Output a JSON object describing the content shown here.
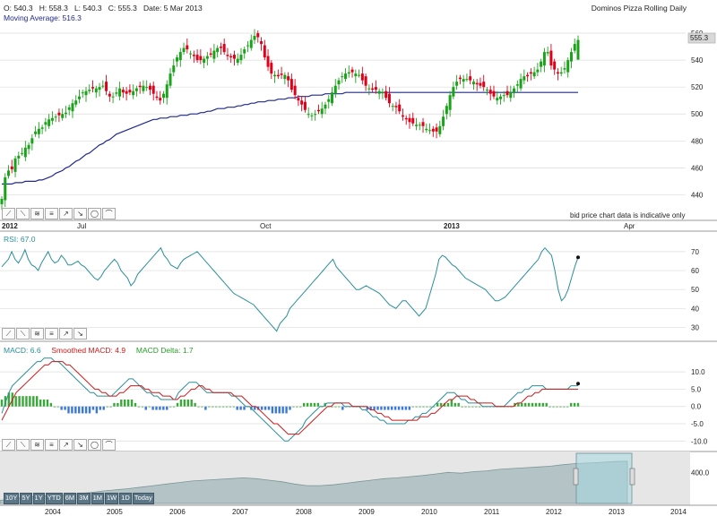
{
  "header": {
    "open": "O: 540.3",
    "high": "H: 558.3",
    "low": "L: 540.3",
    "close": "C: 555.3",
    "date": "Date: 5 Mar 2013",
    "title": "Dominos Pizza Rolling Daily",
    "ma_label": "Moving Average: 516.3",
    "price_tag": "555.3",
    "note": "bid price chart data is indicative only"
  },
  "rsi_label": "RSI: 67.0",
  "macd": {
    "macd_label": "MACD: 6.6",
    "smoothed_label": "Smoothed MACD: 4.9",
    "delta_label": "MACD Delta: 1.7"
  },
  "tool_icons": [
    "line-tool-icon",
    "trend-down-icon",
    "trend-waves-icon",
    "fibonacci-icon",
    "arrow-up-right-icon",
    "arrow-down-right-icon",
    "ellipse-icon",
    "arc-icon"
  ],
  "range_buttons": [
    "10Y",
    "5Y",
    "1Y",
    "YTD",
    "6M",
    "3M",
    "1M",
    "1W",
    "1D",
    "Today"
  ],
  "colors": {
    "up": "#1aa31a",
    "down": "#e0001a",
    "ma": "#1f2a8c",
    "rsi": "#2a8f9a",
    "macd": "#2a8f9a",
    "smoothed": "#d01919",
    "delta_pos": "#3aa83a",
    "delta_neg": "#3b78d8",
    "nav_fill": "#b4c4c6"
  },
  "chart_data": [
    {
      "type": "candlestick",
      "title": "Dominos Pizza Rolling Daily",
      "x_ticks": [
        "2012",
        "Jul",
        "Oct",
        "2013",
        "Apr"
      ],
      "y_ticks": [
        440,
        460,
        480,
        500,
        520,
        540,
        560
      ],
      "ylim": [
        425,
        570
      ],
      "closes": [
        437,
        453,
        458,
        459,
        467,
        469,
        471,
        475,
        477,
        482,
        487,
        489,
        490,
        494,
        496,
        497,
        498,
        499,
        500,
        501,
        505,
        508,
        510,
        513,
        516,
        517,
        518,
        519,
        519,
        520,
        521,
        517,
        513,
        513,
        516,
        519,
        516,
        515,
        516,
        517,
        519,
        520,
        521,
        520,
        518,
        515,
        512,
        510,
        515,
        522,
        530,
        536,
        542,
        546,
        549,
        548,
        545,
        543,
        540,
        540,
        541,
        543,
        544,
        547,
        549,
        549,
        546,
        543,
        542,
        541,
        541,
        544,
        548,
        551,
        555,
        558,
        557,
        552,
        542,
        535,
        530,
        529,
        528,
        529,
        529,
        525,
        518,
        514,
        510,
        507,
        503,
        500,
        499,
        500,
        502,
        504,
        507,
        511,
        516,
        521,
        525,
        528,
        530,
        531,
        531,
        530,
        529,
        525,
        521,
        519,
        518,
        518,
        517,
        516,
        512,
        508,
        506,
        505,
        502,
        498,
        496,
        494,
        493,
        492,
        492,
        491,
        489,
        488,
        487,
        487,
        491,
        498,
        506,
        514,
        520,
        524,
        526,
        526,
        526,
        525,
        524,
        522,
        521,
        520,
        518,
        515,
        513,
        512,
        513,
        514,
        514,
        516,
        519,
        522,
        526,
        528,
        528,
        530,
        531,
        533,
        539,
        546,
        546,
        536,
        533,
        530,
        531,
        534,
        540,
        546,
        552,
        555
      ],
      "moving_average": [
        448,
        448,
        448,
        448,
        449,
        449,
        449,
        450,
        450,
        450,
        450,
        451,
        451,
        452,
        453,
        454,
        456,
        457,
        458,
        460,
        461,
        463,
        465,
        466,
        468,
        470,
        471,
        473,
        475,
        477,
        478,
        480,
        481,
        483,
        485,
        486,
        487,
        488,
        489,
        490,
        491,
        492,
        493,
        494,
        495,
        496,
        496,
        497,
        497,
        497,
        498,
        498,
        498,
        499,
        499,
        499,
        500,
        500,
        500,
        501,
        501,
        502,
        502,
        503,
        504,
        504,
        504,
        505,
        505,
        505,
        506,
        506,
        507,
        507,
        508,
        508,
        509,
        509,
        509,
        510,
        510,
        510,
        511,
        511,
        511,
        512,
        512,
        512,
        513,
        513,
        513,
        513,
        514,
        514,
        514,
        514,
        515,
        515,
        515,
        515,
        515,
        515,
        516,
        516,
        516,
        516,
        516,
        516,
        516,
        516,
        516,
        516,
        516,
        516,
        516,
        516,
        516,
        516,
        516,
        516,
        516,
        516,
        516,
        516,
        516,
        516,
        516,
        516,
        516,
        516,
        516,
        516,
        516,
        516,
        516,
        516,
        516,
        516,
        516,
        516,
        516,
        516,
        516,
        516,
        516,
        516,
        516,
        516,
        516,
        516,
        516,
        516,
        516,
        516,
        516,
        516,
        516,
        516,
        516,
        516,
        516,
        516,
        516,
        516,
        516,
        516,
        516,
        516,
        516,
        516,
        516,
        516
      ],
      "last": {
        "open": 540.3,
        "high": 558.3,
        "low": 540.3,
        "close": 555.3,
        "moving_average": 516.3
      }
    },
    {
      "type": "line",
      "name": "RSI",
      "y_ticks": [
        30,
        40,
        50,
        60,
        70
      ],
      "ylim": [
        25,
        78
      ],
      "values": [
        62,
        64,
        66,
        70,
        66,
        64,
        67,
        71,
        66,
        63,
        62,
        60,
        64,
        67,
        70,
        66,
        64,
        65,
        68,
        66,
        63,
        63,
        64,
        65,
        63,
        62,
        60,
        58,
        56,
        55,
        57,
        60,
        62,
        64,
        66,
        64,
        60,
        58,
        56,
        52,
        54,
        58,
        60,
        62,
        64,
        66,
        68,
        70,
        72,
        68,
        66,
        63,
        62,
        61,
        64,
        66,
        67,
        68,
        69,
        70,
        68,
        66,
        64,
        62,
        60,
        58,
        56,
        54,
        52,
        50,
        48,
        47,
        46,
        45,
        44,
        43,
        42,
        40,
        38,
        36,
        34,
        32,
        30,
        28,
        32,
        34,
        36,
        40,
        42,
        44,
        46,
        48,
        50,
        52,
        54,
        56,
        58,
        60,
        62,
        64,
        66,
        62,
        60,
        58,
        56,
        54,
        52,
        50,
        50,
        51,
        52,
        51,
        50,
        49,
        48,
        46,
        44,
        42,
        41,
        40,
        42,
        44,
        44,
        42,
        40,
        38,
        36,
        38,
        40,
        46,
        52,
        58,
        66,
        68,
        67,
        65,
        63,
        62,
        60,
        58,
        56,
        55,
        54,
        53,
        52,
        51,
        50,
        48,
        46,
        44,
        44,
        45,
        46,
        48,
        50,
        52,
        54,
        56,
        58,
        60,
        62,
        64,
        66,
        70,
        72,
        70,
        68,
        60,
        50,
        44,
        46,
        50,
        56,
        62,
        67
      ]
    },
    {
      "type": "line",
      "name": "MACD",
      "y_ticks": [
        -10,
        -5,
        0,
        5,
        10
      ],
      "ylim": [
        -12,
        16
      ],
      "series": [
        {
          "name": "MACD",
          "values": [
            -2,
            1,
            4,
            6,
            7,
            8,
            9,
            10,
            11,
            12,
            13,
            13,
            14,
            14,
            14,
            13,
            13,
            12,
            11,
            10,
            9,
            8,
            7,
            6,
            5,
            4,
            4,
            3,
            3,
            3,
            3,
            3,
            4,
            5,
            6,
            7,
            8,
            8,
            7,
            6,
            5,
            4,
            4,
            3,
            3,
            2,
            2,
            2,
            2,
            2,
            4,
            5,
            6,
            7,
            7,
            7,
            6,
            5,
            4,
            4,
            4,
            4,
            4,
            4,
            4,
            3,
            3,
            2,
            1,
            0,
            0,
            -1,
            -2,
            -3,
            -4,
            -5,
            -6,
            -7,
            -8,
            -9,
            -10,
            -10,
            -9,
            -8,
            -7,
            -6,
            -4,
            -3,
            -2,
            -1,
            0,
            0,
            1,
            1,
            1,
            1,
            1,
            0,
            0,
            0,
            0,
            0,
            -1,
            -1,
            -2,
            -3,
            -3,
            -4,
            -4,
            -5,
            -5,
            -5,
            -5,
            -5,
            -5,
            -4,
            -4,
            -3,
            -3,
            -2,
            -2,
            -1,
            0,
            1,
            2,
            3,
            4,
            4,
            4,
            3,
            2,
            2,
            1,
            1,
            1,
            1,
            0,
            0,
            0,
            0,
            0,
            0,
            0,
            1,
            2,
            3,
            4,
            4,
            5,
            5,
            6,
            6,
            6,
            6,
            5,
            5,
            5,
            5,
            5,
            5,
            5,
            6,
            6,
            6
          ]
        },
        {
          "name": "Smoothed MACD",
          "values": [
            -4,
            -2,
            0,
            2,
            4,
            5,
            6,
            7,
            8,
            9,
            10,
            11,
            12,
            12,
            13,
            13,
            13,
            13,
            12,
            12,
            11,
            10,
            9,
            8,
            7,
            6,
            5,
            5,
            4,
            4,
            3,
            3,
            3,
            4,
            4,
            5,
            6,
            6,
            6,
            6,
            5,
            5,
            4,
            4,
            4,
            3,
            3,
            3,
            2,
            2,
            3,
            3,
            4,
            5,
            5,
            6,
            6,
            5,
            5,
            4,
            4,
            4,
            4,
            4,
            4,
            3,
            3,
            3,
            2,
            1,
            0,
            0,
            -1,
            -2,
            -3,
            -4,
            -5,
            -5,
            -6,
            -7,
            -8,
            -8,
            -8,
            -8,
            -7,
            -6,
            -5,
            -4,
            -3,
            -2,
            -1,
            0,
            0,
            1,
            1,
            1,
            1,
            1,
            0,
            0,
            0,
            0,
            0,
            -1,
            -1,
            -2,
            -2,
            -3,
            -3,
            -4,
            -4,
            -4,
            -4,
            -4,
            -4,
            -4,
            -4,
            -3,
            -3,
            -3,
            -2,
            -2,
            -1,
            0,
            1,
            2,
            2,
            3,
            3,
            3,
            3,
            2,
            2,
            1,
            1,
            1,
            1,
            1,
            0,
            0,
            0,
            0,
            0,
            0,
            1,
            1,
            2,
            3,
            3,
            4,
            4,
            5,
            5,
            5,
            5,
            5,
            5,
            5,
            5,
            5,
            5,
            5
          ]
        }
      ],
      "delta_values": [
        2,
        3,
        4,
        4,
        3,
        3,
        3,
        3,
        3,
        3,
        3,
        2,
        2,
        2,
        1,
        0,
        0,
        -1,
        -1,
        -2,
        -2,
        -2,
        -2,
        -2,
        -2,
        -2,
        -1,
        -2,
        -1,
        -1,
        0,
        0,
        1,
        1,
        2,
        2,
        2,
        2,
        1,
        0,
        0,
        -1,
        0,
        -1,
        -1,
        -1,
        -1,
        -1,
        0,
        0,
        1,
        2,
        2,
        2,
        2,
        1,
        0,
        0,
        -1,
        0,
        0,
        0,
        0,
        0,
        0,
        0,
        0,
        -1,
        -1,
        -1,
        0,
        -1,
        -1,
        -1,
        -1,
        -1,
        -1,
        -2,
        -2,
        -2,
        -2,
        -2,
        -1,
        0,
        0,
        0,
        1,
        1,
        1,
        1,
        1,
        0,
        1,
        0,
        0,
        0,
        0,
        -1,
        0,
        0,
        0,
        0,
        0,
        0,
        -1,
        -1,
        -1,
        -1,
        -1,
        -1,
        -1,
        -1,
        -1,
        -1,
        -1,
        -1,
        -1,
        0,
        0,
        0,
        0,
        0,
        0,
        0,
        1,
        1,
        1,
        1,
        2,
        1,
        1,
        0,
        0,
        0,
        0,
        0,
        0,
        0,
        0,
        0,
        0,
        0,
        0,
        0,
        0,
        0,
        1,
        1,
        1,
        1,
        1,
        1,
        1,
        1,
        1,
        1,
        0,
        0,
        0,
        0,
        0,
        0,
        1,
        1,
        1
      ],
      "last": {
        "macd": 6.6,
        "smoothed": 4.9,
        "delta": 1.7
      }
    },
    {
      "type": "area",
      "name": "navigator",
      "x_ticks": [
        "2004",
        "2005",
        "2006",
        "2007",
        "2008",
        "2009",
        "2010",
        "2011",
        "2012",
        "2013",
        "2014"
      ],
      "y_ticks": [
        400
      ],
      "values": [
        40,
        60,
        80,
        90,
        100,
        110,
        125,
        140,
        160,
        175,
        190,
        210,
        230,
        250,
        270,
        290,
        300,
        310,
        320,
        330,
        320,
        300,
        280,
        250,
        230,
        230,
        240,
        260,
        280,
        300,
        320,
        330,
        345,
        360,
        380,
        400,
        390,
        410,
        420,
        440,
        450,
        460,
        470,
        480,
        500,
        515,
        520,
        530,
        540,
        545
      ]
    }
  ]
}
